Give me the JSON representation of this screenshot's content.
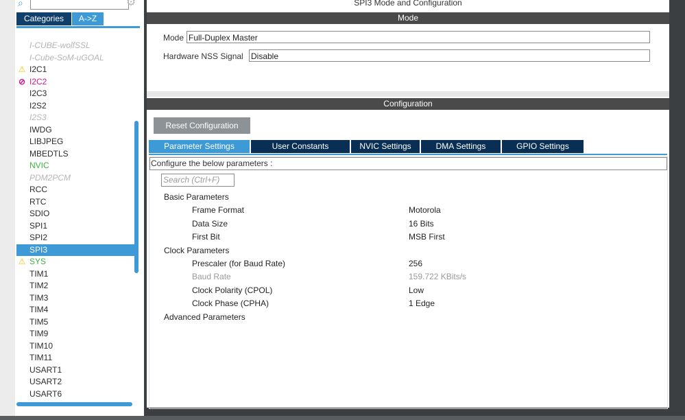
{
  "sidebar": {
    "search_value": "",
    "tabs": [
      "Categories",
      "A->Z"
    ],
    "items": [
      {
        "label": "I-CUBE-wolfSSL",
        "state": "disabled"
      },
      {
        "label": "I-Cube-SoM-uGOAL",
        "state": "disabled"
      },
      {
        "label": "I2C1",
        "state": "warning"
      },
      {
        "label": "I2C2",
        "state": "error"
      },
      {
        "label": "I2C3",
        "state": "normal"
      },
      {
        "label": "I2S2",
        "state": "normal"
      },
      {
        "label": "I2S3",
        "state": "disabled"
      },
      {
        "label": "IWDG",
        "state": "normal"
      },
      {
        "label": "LIBJPEG",
        "state": "normal"
      },
      {
        "label": "MBEDTLS",
        "state": "normal"
      },
      {
        "label": "NVIC",
        "state": "green"
      },
      {
        "label": "PDM2PCM",
        "state": "disabled"
      },
      {
        "label": "RCC",
        "state": "normal"
      },
      {
        "label": "RTC",
        "state": "normal"
      },
      {
        "label": "SDIO",
        "state": "normal"
      },
      {
        "label": "SPI1",
        "state": "normal"
      },
      {
        "label": "SPI2",
        "state": "normal"
      },
      {
        "label": "SPI3",
        "state": "selected"
      },
      {
        "label": "SYS",
        "state": "warning-green"
      },
      {
        "label": "TIM1",
        "state": "normal"
      },
      {
        "label": "TIM2",
        "state": "normal"
      },
      {
        "label": "TIM3",
        "state": "normal"
      },
      {
        "label": "TIM4",
        "state": "normal"
      },
      {
        "label": "TIM5",
        "state": "normal"
      },
      {
        "label": "TIM9",
        "state": "normal"
      },
      {
        "label": "TIM10",
        "state": "normal"
      },
      {
        "label": "TIM11",
        "state": "normal"
      },
      {
        "label": "USART1",
        "state": "normal"
      },
      {
        "label": "USART2",
        "state": "normal"
      },
      {
        "label": "USART6",
        "state": "normal"
      }
    ]
  },
  "panel": {
    "title": "SPI3 Mode and Configuration",
    "mode_header": "Mode",
    "mode_label": "Mode",
    "mode_value": "Full-Duplex Master",
    "nss_label": "Hardware NSS Signal",
    "nss_value": "Disable",
    "config_header": "Configuration",
    "reset_button": "Reset Configuration",
    "tabs": [
      "Parameter Settings",
      "User Constants",
      "NVIC Settings",
      "DMA Settings",
      "GPIO Settings"
    ],
    "params_header": "Configure the below parameters :",
    "search_placeholder": "Search (Ctrl+F)",
    "groups": {
      "basic": "Basic Parameters",
      "clock": "Clock Parameters",
      "advanced": "Advanced Parameters"
    },
    "params": [
      {
        "name": "Frame Format",
        "value": "Motorola"
      },
      {
        "name": "Data Size",
        "value": "16 Bits"
      },
      {
        "name": "First Bit",
        "value": "MSB First"
      },
      {
        "name": "Prescaler (for Baud Rate)",
        "value": "256"
      },
      {
        "name": "Baud Rate",
        "value": "159.722 KBits/s"
      },
      {
        "name": "Clock Polarity (CPOL)",
        "value": "Low"
      },
      {
        "name": "Clock Phase (CPHA)",
        "value": "1 Edge"
      }
    ]
  },
  "colors": {
    "accent": "#3d9ad7",
    "tab_dark": "#0a2f55",
    "header_bar": "#4a4a4a",
    "warning": "#f2c200",
    "error": "#d4168a",
    "ok_green": "#3db23d"
  },
  "icons": {
    "search": "search-icon",
    "settings": "gear-icon",
    "warning": "warning-icon",
    "error": "blocked-icon"
  }
}
